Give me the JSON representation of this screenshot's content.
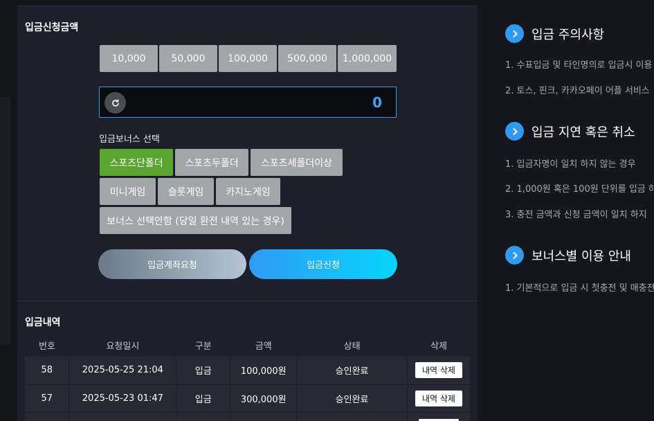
{
  "deposit": {
    "title": "입금신청금액",
    "amounts": [
      "10,000",
      "50,000",
      "100,000",
      "500,000",
      "1,000,000"
    ],
    "current_amount": "0",
    "bonus_label": "입금보너스 선택",
    "bonus_options": [
      "스포츠단폴더",
      "스포츠두폴더",
      "스포츠세폴더이상",
      "미니게임",
      "슬롯게임",
      "카지노게임",
      "보너스 선택안함 (당일 환전 내역 있는 경우)"
    ],
    "selected_bonus": "스포츠단폴더",
    "account_request_label": "입금계좌요청",
    "submit_label": "입금신청"
  },
  "history": {
    "title": "입금내역",
    "columns": [
      "번호",
      "요청일시",
      "구분",
      "금액",
      "상태",
      "삭제"
    ],
    "rows": [
      {
        "no": "58",
        "date": "2025-05-25 21:04",
        "type": "입금",
        "amount": "100,000원",
        "status": "승인완료",
        "action": "내역 삭제"
      },
      {
        "no": "57",
        "date": "2025-05-23 01:47",
        "type": "입금",
        "amount": "300,000원",
        "status": "승인완료",
        "action": "내역 삭제"
      }
    ]
  },
  "notices": [
    {
      "title": "입금 주의사항",
      "lines": [
        "1. 수표입금 및 타인명의로 입금시 이용",
        "2. 토스, 핀크, 카카오페이 어플 서비스"
      ]
    },
    {
      "title": "입금 지연 혹은 취소",
      "lines": [
        "1. 입금자명이 일치 하지 않는 경우",
        "2. 1,000원 혹은 100원 단위를 입금 하",
        "3. 충전 금액과 신청 금액이 일치 하지"
      ]
    },
    {
      "title": "보너스별 이용 안내",
      "lines": [
        "1. 기본적으로 입금 시 첫충전 및 매충전"
      ]
    }
  ],
  "colors": {
    "accent_blue": "#2e9bf1",
    "selected_green": "#5aa52d",
    "status_blue": "#2f85f0"
  },
  "icons": {
    "reset": "reset-icon",
    "notice": "chevron-right-circle-icon"
  }
}
